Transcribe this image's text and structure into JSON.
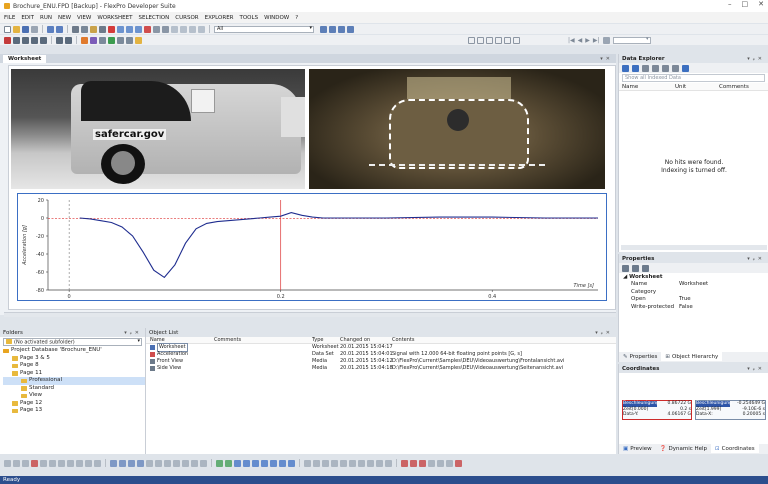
{
  "title": "Brochure_ENU.FPD [Backup] - FlexPro Developer Suite",
  "menu": [
    "FILE",
    "EDIT",
    "RUN",
    "NEW",
    "VIEW",
    "WORKSHEET",
    "SELECTION",
    "CURSOR",
    "EXPLORER",
    "TOOLS",
    "WINDOW",
    "?"
  ],
  "toolbar": {
    "combo_all": "All"
  },
  "worksheet": {
    "tab": "Worksheet",
    "left_video_caption": "safercar.gov",
    "ylabel": "Acceleration [g]",
    "xlabel": "Time [s]"
  },
  "chart_data": {
    "type": "line",
    "xlabel": "Time [s]",
    "ylabel": "Acceleration [g]",
    "xlim": [
      -0.02,
      0.5
    ],
    "ylim": [
      -80,
      20
    ],
    "yticks": [
      20,
      0,
      -20,
      -40,
      -60,
      -80
    ],
    "xticks": [
      0,
      0.2,
      0.4
    ],
    "series": [
      {
        "x": [
          0.01,
          0.02,
          0.03,
          0.04,
          0.05,
          0.06,
          0.07,
          0.08,
          0.09,
          0.1,
          0.11,
          0.12,
          0.13,
          0.14,
          0.15,
          0.16,
          0.17,
          0.18,
          0.19,
          0.2,
          0.21,
          0.22,
          0.23,
          0.24,
          0.26,
          0.3,
          0.35,
          0.4,
          0.45,
          0.5
        ],
        "y": [
          0,
          -1,
          -3,
          -5,
          -10,
          -20,
          -38,
          -58,
          -66,
          -52,
          -28,
          -12,
          -6,
          -4,
          -3,
          -2,
          -1,
          0,
          1,
          2,
          6,
          3,
          1,
          0,
          0,
          0,
          1,
          1,
          0,
          0
        ]
      },
      {
        "x": [
          -0.02,
          0.5
        ],
        "y": [
          -0.5,
          -0.5
        ]
      }
    ]
  },
  "data_explorer": {
    "title": "Data Explorer",
    "search_placeholder": "Show all Indexed Data",
    "columns": [
      "Name",
      "Unit",
      "Comments"
    ],
    "empty_line1": "No hits were found.",
    "empty_line2": "Indexing is turned off."
  },
  "properties": {
    "title": "Properties",
    "group": "Worksheet",
    "rows": [
      {
        "k": "Name",
        "v": "Worksheet"
      },
      {
        "k": "Category",
        "v": ""
      },
      {
        "k": "Open",
        "v": "True"
      },
      {
        "k": "Write-protected",
        "v": "False"
      }
    ],
    "tab1": "Properties",
    "tab2": "Object Hierarchy"
  },
  "coordinates": {
    "title": "Coordinates",
    "box1": [
      "Beschleunigung",
      "Zeit[0.000]",
      "Data-Y:"
    ],
    "box1v": [
      "0.86722 G",
      "0.2 s",
      "4.06167 G"
    ],
    "box2": [
      "Beschleunigung",
      "Zeit[1.999]",
      "Data-X:"
    ],
    "box2v": [
      "-0.254649 G",
      "-9.10E-6 s",
      "0.20005 s"
    ],
    "tabs": [
      "Preview",
      "Dynamic Help",
      "Coordinates"
    ]
  },
  "folders": {
    "title": "Folders",
    "subfolder": "(No activated subfolder)",
    "items": [
      {
        "label": "Project Database 'Brochure_ENU'",
        "indent": 0,
        "sel": false
      },
      {
        "label": "Page 3 & 5",
        "indent": 1,
        "sel": false
      },
      {
        "label": "Page 8",
        "indent": 1,
        "sel": false
      },
      {
        "label": "Page 11",
        "indent": 1,
        "sel": false
      },
      {
        "label": "Professional",
        "indent": 2,
        "sel": true
      },
      {
        "label": "Standard",
        "indent": 2,
        "sel": false
      },
      {
        "label": "View",
        "indent": 2,
        "sel": false
      },
      {
        "label": "Page 12",
        "indent": 1,
        "sel": false
      },
      {
        "label": "Page 13",
        "indent": 1,
        "sel": false
      }
    ]
  },
  "object_list": {
    "title": "Object List",
    "columns": [
      "Name",
      "Comments",
      "Type",
      "Changed on",
      "Contents"
    ],
    "rows": [
      {
        "name": "Worksheet",
        "comments": "",
        "type": "Worksheet",
        "changed": "20.01.2015 15:04:17",
        "contents": ""
      },
      {
        "name": "Acceleration",
        "comments": "",
        "type": "Data Set",
        "changed": "20.01.2015 15:04:01",
        "contents": "Signal with 12.000 64-bit floating point points [G, s]"
      },
      {
        "name": "Front View",
        "comments": "",
        "type": "Media",
        "changed": "20.01.2015 15:04:12",
        "contents": "D:\\FlexPro\\Current\\Samples\\DEU\\Videoauswertung\\Frontalansicht.avi"
      },
      {
        "name": "Side View",
        "comments": "",
        "type": "Media",
        "changed": "20.01.2015 15:04:18",
        "contents": "D:\\FlexPro\\Current\\Samples\\DEU\\Videoauswertung\\Seitenansicht.avi"
      }
    ]
  },
  "status": "Ready"
}
